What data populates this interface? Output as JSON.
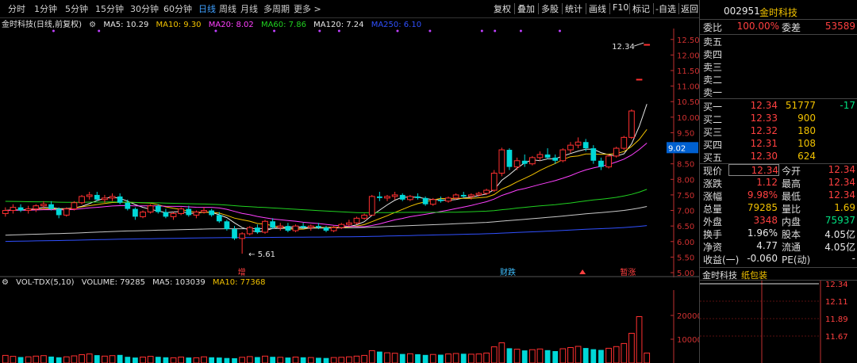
{
  "toolbar": {
    "timeframes": [
      "分时",
      "1分钟",
      "5分钟",
      "15分钟",
      "30分钟",
      "60分钟",
      "日线",
      "周线",
      "月线",
      "多周期",
      "更多 >"
    ],
    "active_timeframe": "日线",
    "tools": [
      "复权",
      "叠加",
      "多股",
      "统计",
      "画线",
      "F10",
      "标记",
      "-自选",
      "返回"
    ]
  },
  "ma_legend": {
    "title": "金时科技(日线,前复权)",
    "ma5": "MA5: 10.29",
    "ma10": "MA10: 9.30",
    "ma20": "MA20: 8.02",
    "ma60": "MA60: 7.86",
    "ma120": "MA120: 7.24",
    "ma250": "MA250: 6.10"
  },
  "vol_legend": {
    "title": "VOL-TDX(5,10)",
    "volume": "VOLUME: 79285",
    "ma5": "MA5: 103039",
    "ma10": "MA10: 77368"
  },
  "annotations": {
    "high": "12.34",
    "low": "5.61",
    "cursor_price": "9.02",
    "markers": [
      "增",
      "财跌",
      "",
      "暂涨"
    ]
  },
  "quote": {
    "code": "002951",
    "name": "金时科技",
    "weibi_label": "委比",
    "weibi_value": "100.00%",
    "weicha_label": "委差",
    "weicha_value": "53589",
    "sells": [
      {
        "label": "卖五",
        "price": "",
        "vol": ""
      },
      {
        "label": "卖四",
        "price": "",
        "vol": ""
      },
      {
        "label": "卖三",
        "price": "",
        "vol": ""
      },
      {
        "label": "卖二",
        "price": "",
        "vol": ""
      },
      {
        "label": "卖一",
        "price": "",
        "vol": ""
      }
    ],
    "buys": [
      {
        "label": "买一",
        "price": "12.34",
        "vol": "51777",
        "chg": "-17"
      },
      {
        "label": "买二",
        "price": "12.33",
        "vol": "900",
        "chg": ""
      },
      {
        "label": "买三",
        "price": "12.32",
        "vol": "180",
        "chg": ""
      },
      {
        "label": "买四",
        "price": "12.31",
        "vol": "108",
        "chg": ""
      },
      {
        "label": "买五",
        "price": "12.30",
        "vol": "624",
        "chg": ""
      }
    ],
    "stats": [
      {
        "l1": "现价",
        "v1": "12.34",
        "c1": "#ff4040",
        "l2": "今开",
        "v2": "12.34",
        "c2": "#ff4040",
        "box": true
      },
      {
        "l1": "涨跌",
        "v1": "1.12",
        "c1": "#ff4040",
        "l2": "最高",
        "v2": "12.34",
        "c2": "#ff4040"
      },
      {
        "l1": "涨幅",
        "v1": "9.98%",
        "c1": "#ff4040",
        "l2": "最低",
        "v2": "12.34",
        "c2": "#ff4040"
      },
      {
        "l1": "总量",
        "v1": "79285",
        "c1": "#f2c200",
        "l2": "量比",
        "v2": "1.69",
        "c2": "#f2c200"
      },
      {
        "l1": "外盘",
        "v1": "3348",
        "c1": "#ff4040",
        "l2": "内盘",
        "v2": "75937",
        "c2": "#00e080"
      },
      {
        "l1": "换手",
        "v1": "1.96%",
        "c1": "#e8e8e8",
        "l2": "股本",
        "v2": "4.05亿",
        "c2": "#e8e8e8"
      },
      {
        "l1": "净资",
        "v1": "4.77",
        "c1": "#e8e8e8",
        "l2": "流通",
        "v2": "4.05亿",
        "c2": "#e8e8e8"
      },
      {
        "l1": "收益(一)",
        "v1": "-0.060",
        "c1": "#e8e8e8",
        "l2": "PE(动)",
        "v2": "-",
        "c2": "#e8e8e8"
      }
    ],
    "tab1": "金时科技",
    "tab2": "纸包装",
    "mini_ticks": [
      "12.34",
      "12.11",
      "11.89",
      "11.67"
    ]
  },
  "chart_data": [
    {
      "type": "candlestick",
      "title": "金时科技(日线,前复权)",
      "ylim": [
        5.0,
        12.8
      ],
      "y_ticks": [
        "12.50",
        "12.00",
        "11.50",
        "11.00",
        "10.50",
        "10.00",
        "9.50",
        "9.00",
        "8.50",
        "8.00",
        "7.50",
        "7.00",
        "6.50",
        "6.00",
        "5.50",
        "5.00"
      ],
      "ohlc": [
        [
          6.9,
          7.1,
          6.8,
          7.0
        ],
        [
          7.0,
          7.2,
          6.9,
          7.1
        ],
        [
          7.1,
          7.2,
          6.95,
          7.0
        ],
        [
          7.0,
          7.15,
          6.9,
          7.05
        ],
        [
          7.05,
          7.2,
          6.95,
          7.15
        ],
        [
          7.15,
          7.3,
          7.05,
          7.2
        ],
        [
          7.2,
          7.3,
          7.0,
          7.05
        ],
        [
          7.05,
          7.1,
          6.75,
          6.85
        ],
        [
          6.85,
          7.1,
          6.8,
          7.05
        ],
        [
          7.05,
          7.3,
          7.0,
          7.25
        ],
        [
          7.25,
          7.5,
          7.2,
          7.45
        ],
        [
          7.45,
          7.6,
          7.35,
          7.5
        ],
        [
          7.5,
          7.6,
          7.3,
          7.35
        ],
        [
          7.35,
          7.5,
          7.25,
          7.4
        ],
        [
          7.4,
          7.55,
          7.3,
          7.45
        ],
        [
          7.45,
          7.55,
          7.2,
          7.25
        ],
        [
          7.25,
          7.35,
          7.0,
          7.05
        ],
        [
          7.05,
          7.1,
          6.7,
          6.8
        ],
        [
          6.8,
          7.0,
          6.75,
          6.95
        ],
        [
          6.95,
          7.2,
          6.9,
          7.15
        ],
        [
          7.15,
          7.2,
          6.9,
          6.95
        ],
        [
          6.95,
          7.05,
          6.75,
          6.8
        ],
        [
          6.8,
          6.95,
          6.7,
          6.9
        ],
        [
          6.9,
          7.1,
          6.85,
          7.05
        ],
        [
          7.05,
          7.15,
          6.8,
          6.85
        ],
        [
          6.85,
          7.0,
          6.75,
          6.95
        ],
        [
          6.95,
          7.1,
          6.9,
          7.0
        ],
        [
          7.0,
          7.05,
          6.8,
          6.85
        ],
        [
          6.85,
          6.95,
          6.6,
          6.65
        ],
        [
          6.65,
          6.7,
          6.35,
          6.4
        ],
        [
          6.4,
          6.5,
          6.05,
          6.1
        ],
        [
          6.1,
          6.3,
          5.61,
          6.25
        ],
        [
          6.25,
          6.5,
          6.2,
          6.45
        ],
        [
          6.45,
          6.55,
          6.25,
          6.3
        ],
        [
          6.3,
          6.7,
          6.25,
          6.65
        ],
        [
          6.65,
          6.75,
          6.4,
          6.45
        ],
        [
          6.45,
          6.6,
          6.35,
          6.5
        ],
        [
          6.5,
          6.6,
          6.3,
          6.35
        ],
        [
          6.35,
          6.55,
          6.3,
          6.5
        ],
        [
          6.5,
          6.6,
          6.4,
          6.45
        ],
        [
          6.45,
          6.55,
          6.35,
          6.5
        ],
        [
          6.5,
          6.6,
          6.4,
          6.45
        ],
        [
          6.45,
          6.5,
          6.3,
          6.35
        ],
        [
          6.35,
          6.5,
          6.3,
          6.45
        ],
        [
          6.45,
          6.6,
          6.4,
          6.55
        ],
        [
          6.55,
          6.7,
          6.5,
          6.6
        ],
        [
          6.6,
          6.8,
          6.55,
          6.75
        ],
        [
          6.75,
          6.9,
          6.7,
          6.85
        ],
        [
          6.85,
          7.5,
          6.85,
          7.45
        ],
        [
          7.45,
          7.6,
          7.3,
          7.4
        ],
        [
          7.4,
          7.5,
          7.3,
          7.45
        ],
        [
          7.45,
          7.6,
          7.35,
          7.5
        ],
        [
          7.5,
          7.55,
          7.3,
          7.35
        ],
        [
          7.35,
          7.5,
          7.3,
          7.45
        ],
        [
          7.45,
          7.55,
          7.35,
          7.4
        ],
        [
          7.4,
          7.45,
          7.15,
          7.2
        ],
        [
          7.2,
          7.4,
          7.15,
          7.35
        ],
        [
          7.35,
          7.45,
          7.25,
          7.3
        ],
        [
          7.3,
          7.45,
          7.25,
          7.4
        ],
        [
          7.4,
          7.55,
          7.35,
          7.5
        ],
        [
          7.5,
          7.6,
          7.4,
          7.45
        ],
        [
          7.45,
          7.55,
          7.35,
          7.5
        ],
        [
          7.5,
          7.6,
          7.45,
          7.55
        ],
        [
          7.55,
          7.7,
          7.5,
          7.65
        ],
        [
          7.65,
          8.3,
          7.6,
          8.2
        ],
        [
          8.2,
          9.02,
          8.1,
          8.95
        ],
        [
          8.95,
          9.0,
          8.3,
          8.4
        ],
        [
          8.4,
          8.7,
          8.3,
          8.6
        ],
        [
          8.6,
          8.8,
          8.4,
          8.5
        ],
        [
          8.5,
          8.75,
          8.45,
          8.7
        ],
        [
          8.7,
          8.9,
          8.6,
          8.8
        ],
        [
          8.8,
          9.0,
          8.65,
          8.7
        ],
        [
          8.7,
          8.8,
          8.5,
          8.6
        ],
        [
          8.6,
          9.0,
          8.55,
          8.95
        ],
        [
          8.95,
          9.2,
          8.85,
          9.1
        ],
        [
          9.1,
          9.35,
          9.0,
          9.2
        ],
        [
          9.2,
          9.3,
          8.9,
          9.0
        ],
        [
          9.0,
          9.1,
          8.5,
          8.6
        ],
        [
          8.6,
          8.7,
          8.3,
          8.4
        ],
        [
          8.4,
          8.8,
          8.35,
          8.75
        ],
        [
          8.75,
          9.05,
          8.7,
          9.0
        ],
        [
          9.0,
          9.4,
          8.95,
          9.35
        ],
        [
          9.35,
          10.25,
          9.3,
          10.2
        ],
        [
          11.22,
          11.22,
          11.22,
          11.22
        ],
        [
          12.34,
          12.34,
          12.34,
          12.34
        ]
      ],
      "ma5_note": "MA5 10.29, MA10 9.30, MA20 8.02, MA60 7.86, MA120 7.24, MA250 6.10"
    },
    {
      "type": "bar",
      "title": "VOL-TDX(5,10)",
      "ylim": [
        0,
        30000
      ],
      "y_ticks": [
        "20000",
        "10000"
      ],
      "values": [
        3200,
        2800,
        2500,
        2600,
        2900,
        3100,
        2700,
        2400,
        2600,
        3000,
        3500,
        3800,
        3300,
        2900,
        3100,
        3400,
        2600,
        2300,
        2500,
        2800,
        2600,
        2400,
        2200,
        2500,
        2300,
        2200,
        2600,
        2400,
        2300,
        2100,
        2000,
        2400,
        2700,
        2500,
        2900,
        2600,
        2400,
        2300,
        2500,
        2400,
        2300,
        2200,
        2100,
        2300,
        2400,
        2600,
        2900,
        3200,
        5200,
        4800,
        4300,
        4100,
        3800,
        3900,
        3700,
        3400,
        3600,
        3500,
        3800,
        4000,
        3900,
        3700,
        3800,
        4200,
        6800,
        8500,
        6200,
        5800,
        5300,
        5600,
        5900,
        5400,
        5000,
        6000,
        6500,
        7000,
        6300,
        5800,
        5500,
        6200,
        6900,
        8200,
        12500,
        19500,
        4200
      ]
    }
  ]
}
